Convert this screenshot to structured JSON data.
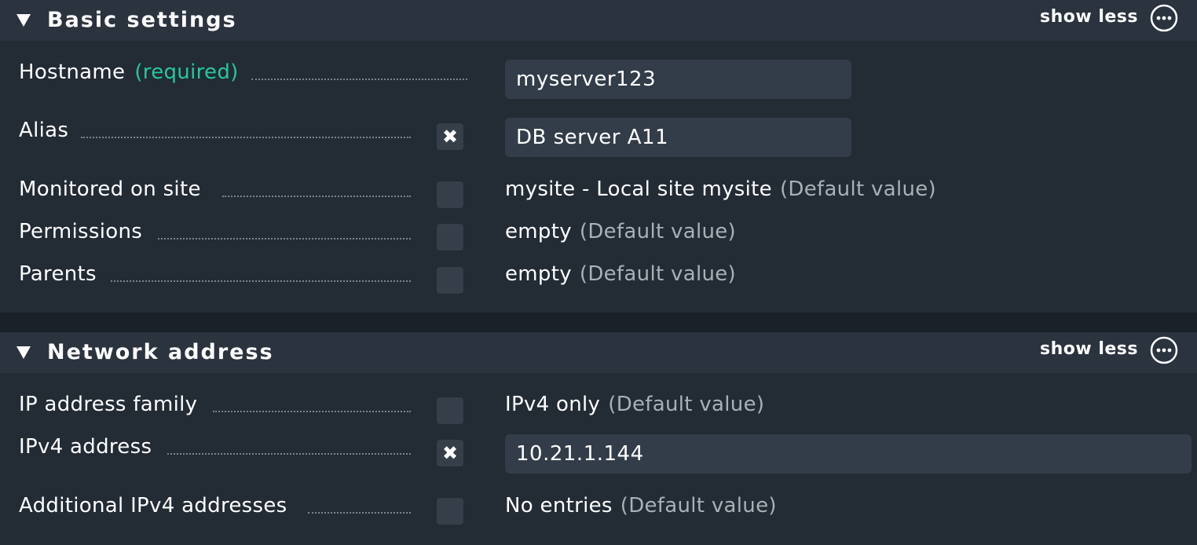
{
  "sections": {
    "basic": {
      "title": "Basic settings",
      "show_less": "show less",
      "hostname": {
        "label": "Hostname",
        "required": "(required)",
        "value": "myserver123"
      },
      "alias": {
        "label": "Alias",
        "checked_mark": "✖",
        "value": "DB server A11"
      },
      "monitored_site": {
        "label": "Monitored on site",
        "value": "mysite - Local site mysite",
        "default": "(Default value)"
      },
      "permissions": {
        "label": "Permissions",
        "value": "empty",
        "default": "(Default value)"
      },
      "parents": {
        "label": "Parents",
        "value": "empty",
        "default": "(Default value)"
      }
    },
    "network": {
      "title": "Network address",
      "show_less": "show less",
      "ip_family": {
        "label": "IP address family",
        "value": "IPv4 only",
        "default": "(Default value)"
      },
      "ipv4": {
        "label": "IPv4 address",
        "checked_mark": "✖",
        "value": "10.21.1.144"
      },
      "additional_ipv4": {
        "label": "Additional IPv4 addresses",
        "value": "No entries",
        "default": "(Default value)"
      }
    }
  },
  "icons": {
    "collapse": "triangle-down-icon",
    "more": "more-options-icon",
    "checked": "x-mark-icon"
  },
  "colors": {
    "required": "#26c89a",
    "default_value": "#a9b0b7",
    "section_bg": "#232b35",
    "header_bg": "#2a333e"
  }
}
